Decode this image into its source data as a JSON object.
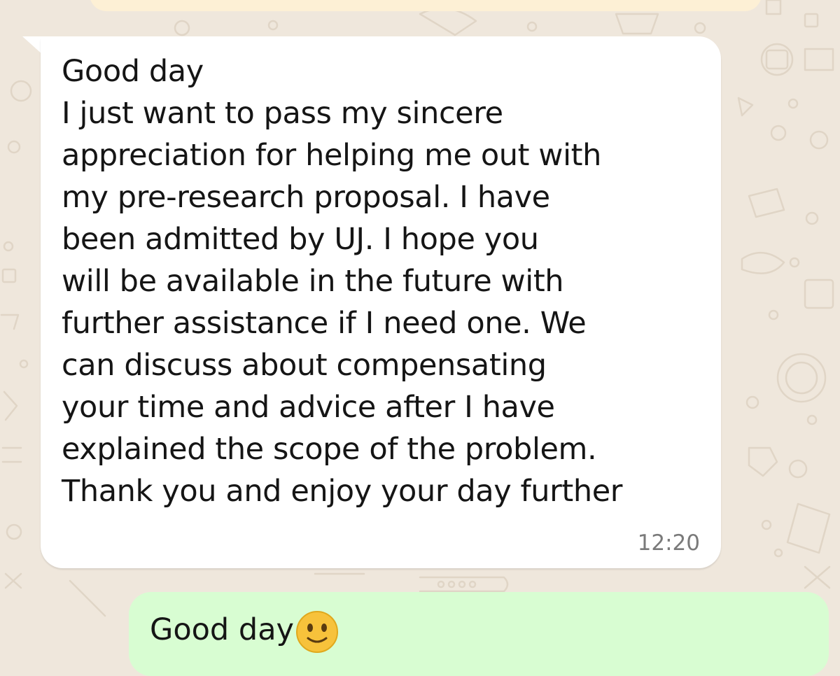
{
  "chat": {
    "incoming_message": {
      "lines": [
        "Good day",
        "I just want to pass my sincere",
        "appreciation for helping me out with",
        "my pre-research proposal. I have",
        "been admitted by UJ. I hope you",
        "will be available in the future with",
        "further assistance if I need one. We",
        "can discuss about compensating",
        "your time and advice after I have",
        "explained the scope of the problem.",
        "Thank you and enjoy your day further"
      ],
      "time": "12:20"
    },
    "outgoing_message": {
      "text": "Good day",
      "emoji_icon": "slightly-smiling-face-emoji"
    },
    "colors": {
      "wallpaper": "#efe7dc",
      "incoming_bubble": "#ffffff",
      "outgoing_bubble": "#d8fdd2",
      "top_bubble": "#fdf0d5"
    }
  }
}
